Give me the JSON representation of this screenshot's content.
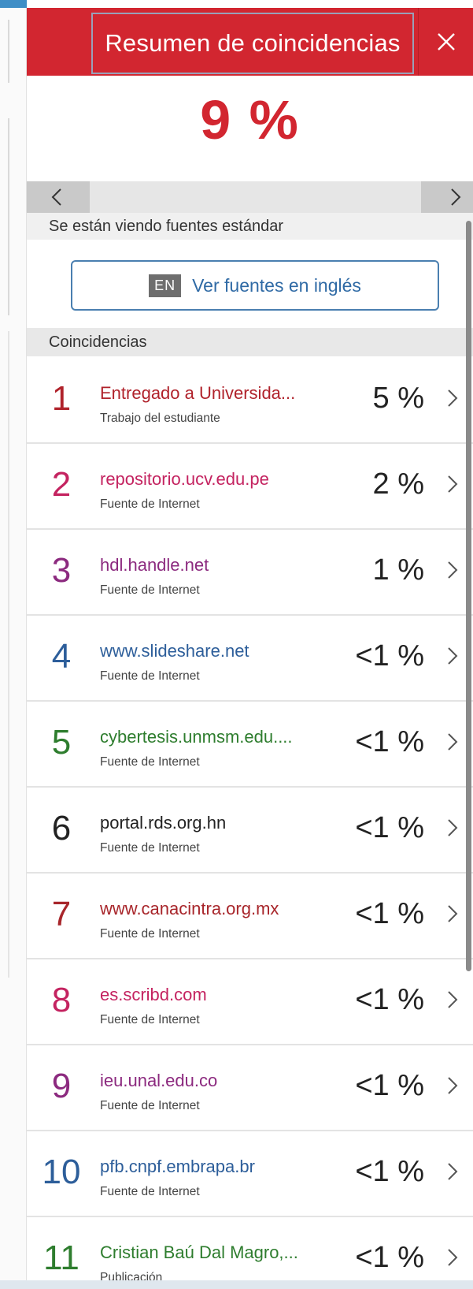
{
  "header": {
    "title": "Resumen de coincidencias",
    "close_icon": "close-icon"
  },
  "score": "9 %",
  "nav": {
    "prev_icon": "chevron-left-icon",
    "next_icon": "chevron-right-icon"
  },
  "status_text": "Se están viendo fuentes estándar",
  "language_button": {
    "tag": "EN",
    "label": "Ver fuentes en inglés"
  },
  "section_title": "Coincidencias",
  "matches": [
    {
      "number": "1",
      "name": "Entregado a Universida...",
      "kind": "Trabajo del estudiante",
      "percent": "5 %",
      "color": "#b0222b"
    },
    {
      "number": "2",
      "name": "repositorio.ucv.edu.pe",
      "kind": "Fuente de Internet",
      "percent": "2 %",
      "color": "#c42360"
    },
    {
      "number": "3",
      "name": "hdl.handle.net",
      "kind": "Fuente de Internet",
      "percent": "1 %",
      "color": "#8c2a7f"
    },
    {
      "number": "4",
      "name": "www.slideshare.net",
      "kind": "Fuente de Internet",
      "percent": "<1 %",
      "color": "#2d5e9a"
    },
    {
      "number": "5",
      "name": "cybertesis.unmsm.edu....",
      "kind": "Fuente de Internet",
      "percent": "<1 %",
      "color": "#2e7d2e"
    },
    {
      "number": "6",
      "name": "portal.rds.org.hn",
      "kind": "Fuente de Internet",
      "percent": "<1 %",
      "color": "#222222"
    },
    {
      "number": "7",
      "name": "www.canacintra.org.mx",
      "kind": "Fuente de Internet",
      "percent": "<1 %",
      "color": "#a8262b"
    },
    {
      "number": "8",
      "name": "es.scribd.com",
      "kind": "Fuente de Internet",
      "percent": "<1 %",
      "color": "#c42360"
    },
    {
      "number": "9",
      "name": "ieu.unal.edu.co",
      "kind": "Fuente de Internet",
      "percent": "<1 %",
      "color": "#8c2a7f"
    },
    {
      "number": "10",
      "name": "pfb.cnpf.embrapa.br",
      "kind": "Fuente de Internet",
      "percent": "<1 %",
      "color": "#2d5e9a"
    },
    {
      "number": "11",
      "name": "Cristian Baú Dal Magro,...",
      "kind": "Publicación",
      "percent": "<1 %",
      "color": "#2e7d2e"
    }
  ],
  "colors": {
    "brand_red": "#d22630",
    "link_blue": "#2f6aa5"
  }
}
